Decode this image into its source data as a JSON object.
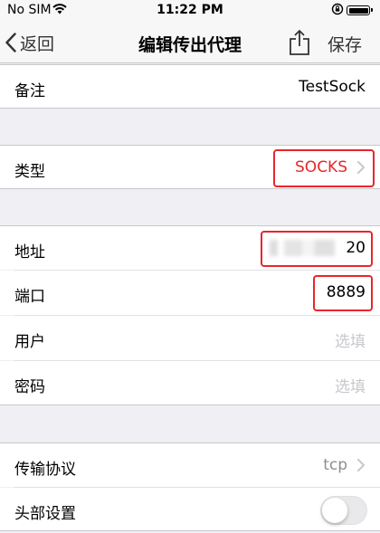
{
  "status_bar": {
    "carrier": "No SIM",
    "time": "11:22 PM",
    "icons": [
      "wifi-icon",
      "orientation-lock-icon",
      "battery-icon"
    ]
  },
  "nav": {
    "back_label": "返回",
    "title": "编辑传出代理",
    "save_label": "保存",
    "icons": [
      "chevron-left-icon",
      "share-icon"
    ]
  },
  "rows": {
    "remark": {
      "label": "备注",
      "value": "TestSock"
    },
    "type": {
      "label": "类型",
      "value": "SOCKS"
    },
    "address": {
      "label": "地址",
      "value_suffix": "20"
    },
    "port": {
      "label": "端口",
      "value": "8889"
    },
    "user": {
      "label": "用户",
      "placeholder": "选填"
    },
    "password": {
      "label": "密码",
      "placeholder": "选填"
    },
    "transport": {
      "label": "传输协议",
      "value": "tcp"
    },
    "header": {
      "label": "头部设置",
      "toggle_on": false
    }
  },
  "colors": {
    "accent_red": "#e8262b",
    "type_value": "#e8262b",
    "placeholder": "#c7c7cd",
    "background": "#efeff4"
  }
}
